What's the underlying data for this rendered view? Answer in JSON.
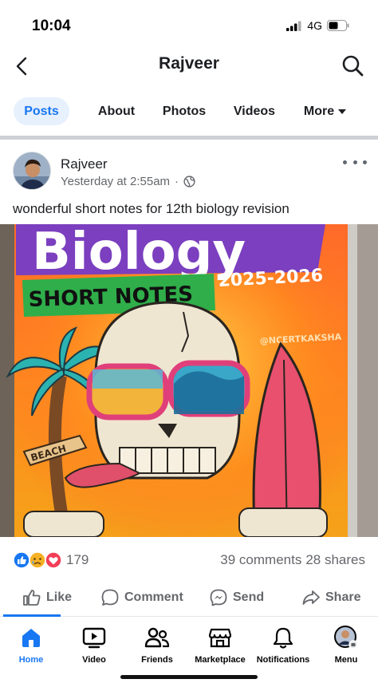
{
  "status_bar": {
    "time": "10:04",
    "network": "4G"
  },
  "header": {
    "title": "Rajveer"
  },
  "tabs": [
    {
      "label": "Posts",
      "active": true
    },
    {
      "label": "About"
    },
    {
      "label": "Photos"
    },
    {
      "label": "Videos"
    },
    {
      "label": "More"
    }
  ],
  "post": {
    "author": "Rajveer",
    "timestamp": "Yesterday at 2:55am",
    "separator": "·",
    "text": "wonderful short notes for 12th biology revision",
    "image": {
      "title": "Biology",
      "subtitle": "SHORT NOTES",
      "year": "2025-2026",
      "handle": "@NCERTKAKSHA",
      "sign": "BEACH"
    },
    "reaction_count": "179",
    "comments": "39 comments",
    "shares": "28 shares"
  },
  "actions": {
    "like": "Like",
    "comment": "Comment",
    "send": "Send",
    "share": "Share"
  },
  "bottom_nav": [
    {
      "label": "Home",
      "active": true
    },
    {
      "label": "Video"
    },
    {
      "label": "Friends"
    },
    {
      "label": "Marketplace"
    },
    {
      "label": "Notifications"
    },
    {
      "label": "Menu"
    }
  ],
  "colors": {
    "accent": "#1877f2",
    "secondary_text": "#65676b",
    "tab_active_bg": "#e7f0fd"
  }
}
